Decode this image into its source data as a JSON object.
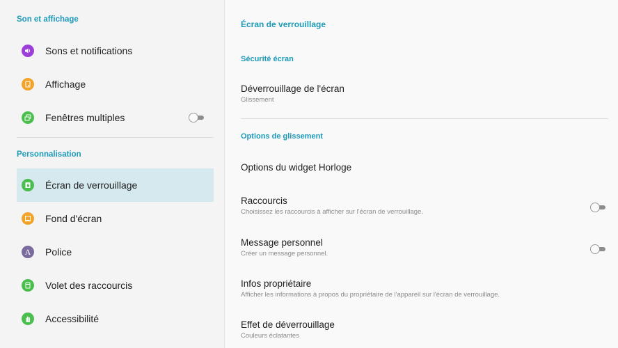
{
  "left": {
    "section_sound_display": "Son et affichage",
    "section_personalization": "Personnalisation",
    "items": [
      {
        "label": "Sons et notifications",
        "icon": "speaker-icon",
        "color": "#9c3fd8"
      },
      {
        "label": "Affichage",
        "icon": "display-icon",
        "color": "#f0a42c"
      },
      {
        "label": "Fenêtres multiples",
        "icon": "multi-window-icon",
        "color": "#4bbf4d",
        "toggle": "off"
      },
      {
        "label": "Écran de verrouillage",
        "icon": "lock-screen-icon",
        "color": "#4bbf4d",
        "selected": true
      },
      {
        "label": "Fond d'écran",
        "icon": "wallpaper-icon",
        "color": "#f0a42c"
      },
      {
        "label": "Police",
        "icon": "font-icon",
        "color": "#7a6a9e",
        "glyph": "A"
      },
      {
        "label": "Volet des raccourcis",
        "icon": "shortcut-panel-icon",
        "color": "#4bbf4d"
      },
      {
        "label": "Accessibilité",
        "icon": "hand-icon",
        "color": "#4bbf4d"
      }
    ]
  },
  "right": {
    "page_title": "Écran de verrouillage",
    "section_security": "Sécurité écran",
    "section_swipe": "Options de glissement",
    "items": [
      {
        "title": "Déverrouillage de l'écran",
        "subtitle": "Glissement"
      },
      {
        "title": "Options du widget Horloge",
        "subtitle": ""
      },
      {
        "title": "Raccourcis",
        "subtitle": "Choisissez les raccourcis à afficher sur l'écran de verrouillage.",
        "toggle": "off"
      },
      {
        "title": "Message personnel",
        "subtitle": "Créer un message personnel.",
        "toggle": "off"
      },
      {
        "title": "Infos propriétaire",
        "subtitle": "Afficher les informations à propos du propriétaire de l'appareil sur l'écran de verrouillage."
      },
      {
        "title": "Effet de déverrouillage",
        "subtitle": "Couleurs éclatantes"
      }
    ]
  },
  "colors": {
    "accent": "#1c9ab7",
    "selected_bg": "#d6e9ee"
  }
}
